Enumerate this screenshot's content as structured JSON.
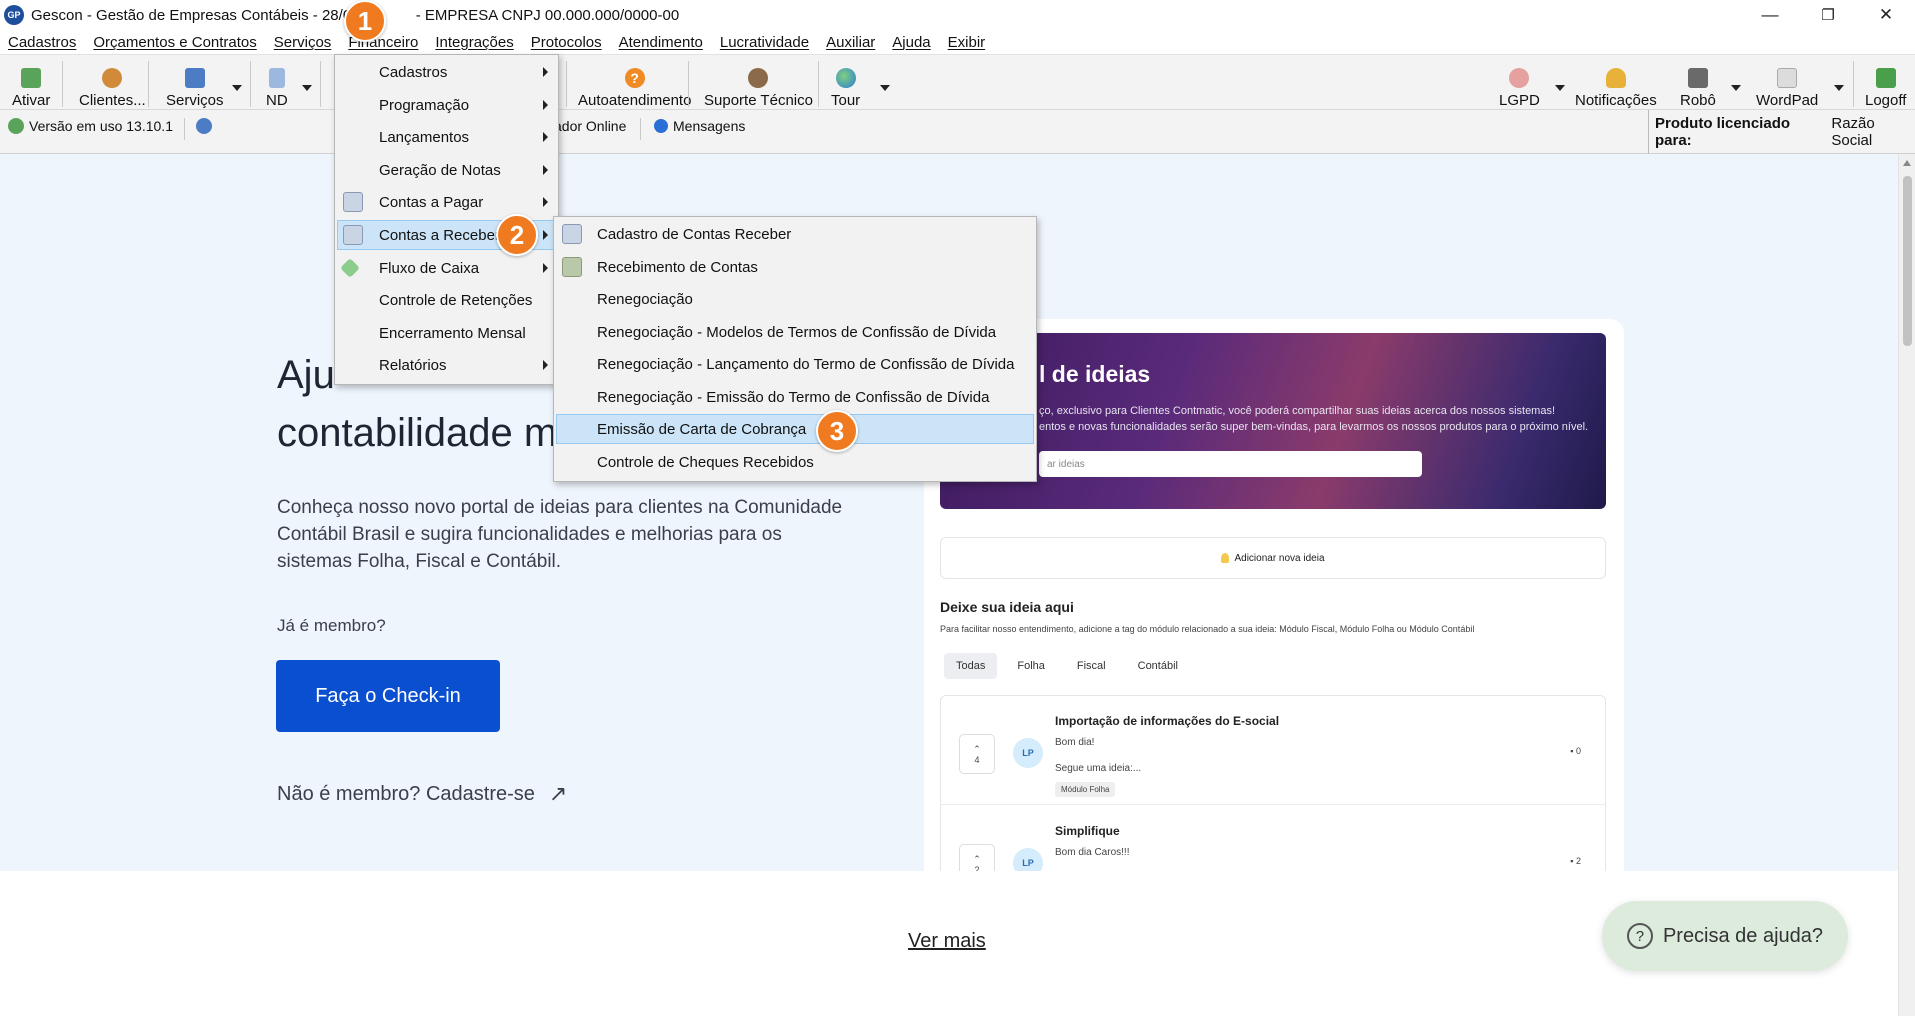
{
  "window": {
    "logo": "GP",
    "title": "Gescon - Gestão de Empresas Contábeis - 28/01/",
    "title_suffix": "- EMPRESA CNPJ 00.000.000/0000-00",
    "minimize_icon": "—",
    "restore_icon": "❐",
    "close_icon": "✕"
  },
  "menubar": [
    "Cadastros",
    "Orçamentos e Contratos",
    "Serviços",
    "Financeiro",
    "Integrações",
    "Protocolos",
    "Atendimento",
    "Lucratividade",
    "Auxiliar",
    "Ajuda",
    "Exibir"
  ],
  "toolbar": {
    "ativar": "Ativar",
    "clientes": "Clientes...",
    "servicos": "Serviços",
    "nd": "ND",
    "autoatendimento": "Autoatendimento",
    "suporte": "Suporte Técnico",
    "tour": "Tour",
    "lgpd": "LGPD",
    "notificacoes": "Notificações",
    "robo": "Robô",
    "wordpad": "WordPad",
    "logoff": "Logoff",
    "help_icon_glyph": "?"
  },
  "infobar": {
    "version": "Versão em uso 13.10.1",
    "online": "ador Online",
    "messages": "Mensagens",
    "licensed_label": "Produto licenciado para:",
    "licensed_value": "Razão Social"
  },
  "financeiro_menu": [
    "Cadastros",
    "Programação",
    "Lançamentos",
    "Geração de Notas",
    "Contas a Pagar",
    "Contas a Receber",
    "Fluxo de Caixa",
    "Controle de Retenções",
    "Encerramento Mensal",
    "Relatórios"
  ],
  "contas_receber_menu": [
    "Cadastro de Contas Receber",
    "Recebimento de Contas",
    "Renegociação",
    "Renegociação - Modelos de Termos de Confissão de Dívida",
    "Renegociação - Lançamento do Termo de Confissão de Dívida",
    "Renegociação - Emissão do Termo de Confissão de Dívida",
    "Emissão de Carta de Cobrança",
    "Controle de Cheques Recebidos"
  ],
  "hero": {
    "title_line1": "Aju",
    "title_line2": "contabilidade m",
    "description": "Conheça nosso novo portal de ideias para clientes na Comunidade Contábil Brasil e sugira funcionalidades e melhorias para os sistemas Folha, Fiscal e Contábil.",
    "member_q": "Já é membro?",
    "checkin": "Faça o Check-in",
    "signup": "Não é membro? Cadastre-se",
    "signup_arrow": "↗"
  },
  "portal": {
    "banner_title": "l de ideias",
    "banner_text_1": "ço, exclusivo para Clientes Contmatic, você poderá compartilhar suas ideias acerca dos nossos sistemas!",
    "banner_text_2": "entos e novas funcionalidades serão super bem-vindas, para levarmos os nossos produtos para o próximo nível.",
    "search_placeholder": "ar ideias",
    "add_idea": "Adicionar nova ideia",
    "section_title": "Deixe sua ideia aqui",
    "section_sub": "Para facilitar nosso entendimento, adicione a tag do módulo relacionado a sua ideia: Módulo Fiscal, Módulo Folha ou Módulo Contábil",
    "tabs": [
      "Todas",
      "Folha",
      "Fiscal",
      "Contábil"
    ],
    "ideas": [
      {
        "title": "Importação de informações do E-social",
        "line1": "Bom dia!",
        "line2": "Segue uma ideia:...",
        "tag": "Módulo Folha",
        "votes": "4",
        "avatar": "LP",
        "comments": "0"
      },
      {
        "title": "Simplifique",
        "line1": "Bom dia Caros!!!",
        "line2": "",
        "tag": "",
        "votes": "2",
        "avatar": "LP",
        "comments": "2"
      }
    ]
  },
  "footer": {
    "ver_mais": "Ver mais",
    "help": "Precisa de ajuda?"
  },
  "badges": [
    "1",
    "2",
    "3"
  ],
  "colors": {
    "accent": "#0a4fcf",
    "badge": "#f07a1f",
    "highlight": "#cce4f7"
  }
}
